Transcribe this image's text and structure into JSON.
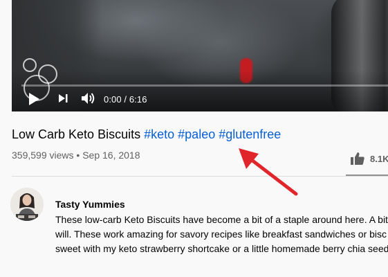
{
  "player": {
    "time_display": "0:00 / 6:16",
    "progress": 0
  },
  "video": {
    "title_text": "Low Carb Keto Biscuits ",
    "hashtags": [
      "#keto",
      "#paleo",
      "#glutenfree"
    ],
    "views": "359,599 views",
    "separator": "•",
    "date": "Sep 16, 2018",
    "likes": "8.1K"
  },
  "channel": {
    "name": "Tasty Yummies"
  },
  "description": {
    "lines": [
      "These low-carb Keto Biscuits have become a bit of a staple around here. A bit",
      "will. These work amazing for savory recipes like breakfast sandwiches or bisc",
      "sweet with my keto strawberry shortcake or a little homemade berry chia seed"
    ]
  },
  "annotation": {
    "arrow_color": "#e0262b"
  },
  "colors": {
    "hashtag": "#065fd4",
    "meta": "#606060"
  },
  "icons": {
    "play": "play-icon",
    "next": "next-icon",
    "volume": "volume-icon",
    "like": "thumbs-up-icon"
  }
}
